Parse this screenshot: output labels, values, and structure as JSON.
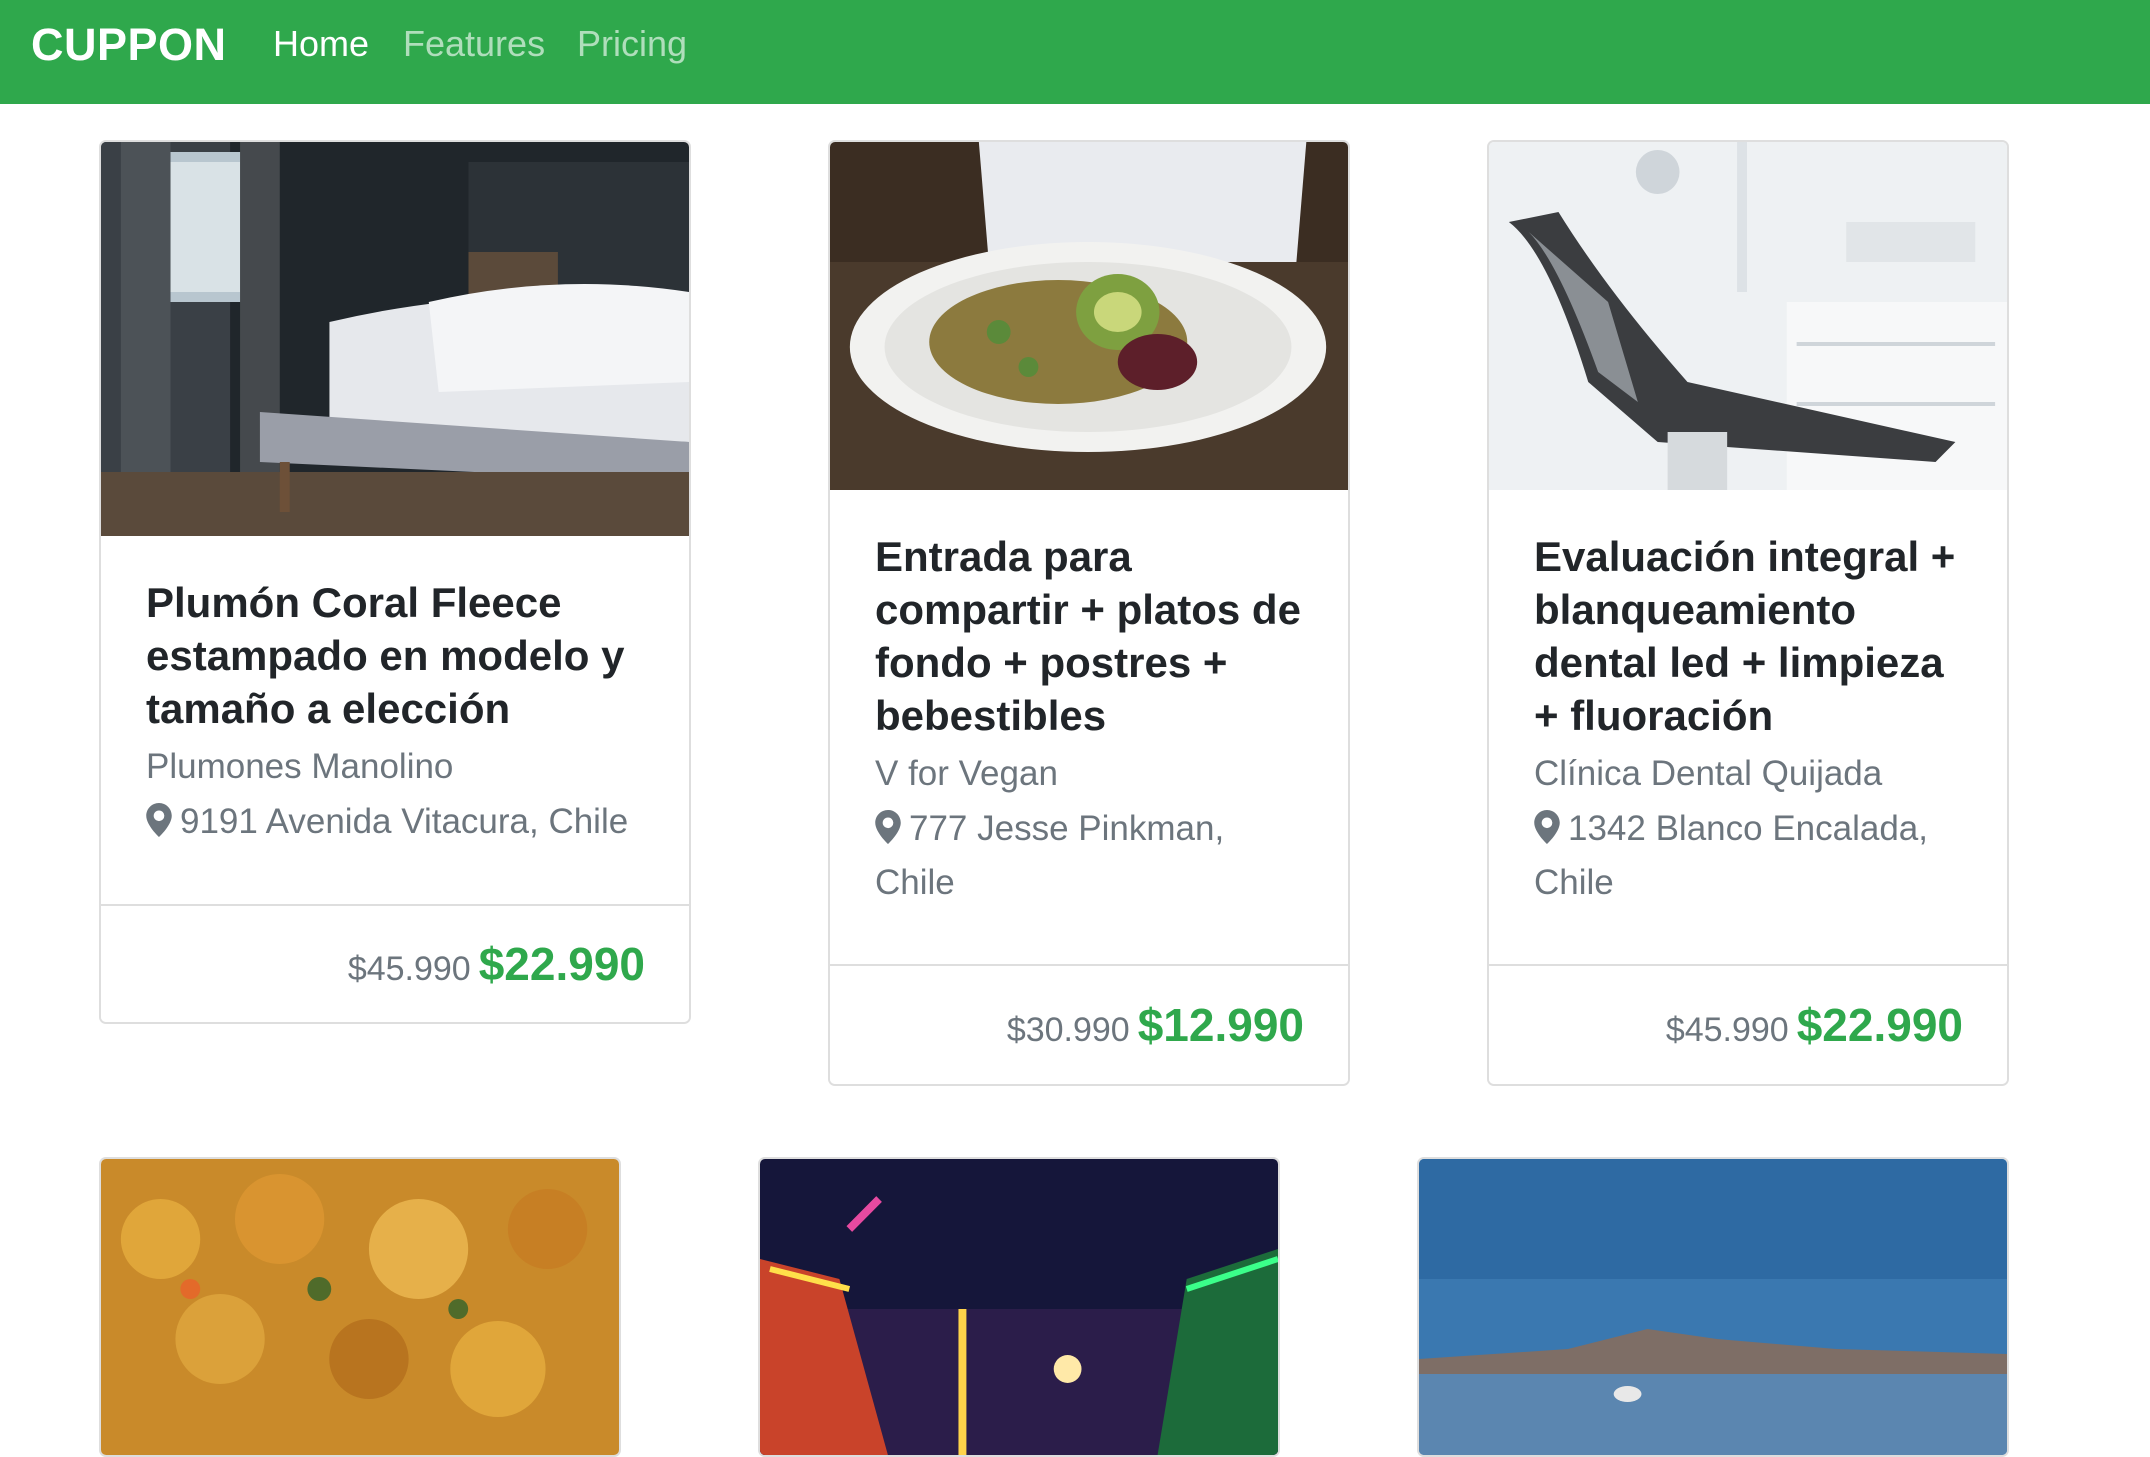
{
  "navbar": {
    "brand": "CUPPON",
    "links": [
      {
        "label": "Home",
        "active": true
      },
      {
        "label": "Features",
        "active": false
      },
      {
        "label": "Pricing",
        "active": false
      }
    ],
    "color": "#2fa84c"
  },
  "deals": [
    {
      "title": "Plumón Coral Fleece estampado en modelo y tamaño a elección",
      "merchant": "Plumones Manolino",
      "location": "9191 Avenida Vitacura, Chile",
      "old_price": "$45.990",
      "price": "$22.990",
      "image": "bedroom-photo"
    },
    {
      "title": "Entrada para compartir + platos de fondo + postres + bebestibles",
      "merchant": "V for Vegan",
      "location": "777 Jesse Pinkman, Chile",
      "old_price": "$30.990",
      "price": "$12.990",
      "image": "vegan-salad-photo"
    },
    {
      "title": "Evaluación integral + blanqueamiento dental led + limpieza + fluoración",
      "merchant": "Clínica Dental Quijada",
      "location": "1342 Blanco Encalada, Chile",
      "old_price": "$45.990",
      "price": "$22.990",
      "image": "dental-chair-photo"
    }
  ],
  "partial_cards": [
    {
      "image": "food-stew-photo"
    },
    {
      "image": "carnival-night-photo"
    },
    {
      "image": "lake-mountain-photo"
    }
  ],
  "colors": {
    "price": "#2fa84c",
    "muted": "#6c757d",
    "text": "#212529"
  }
}
